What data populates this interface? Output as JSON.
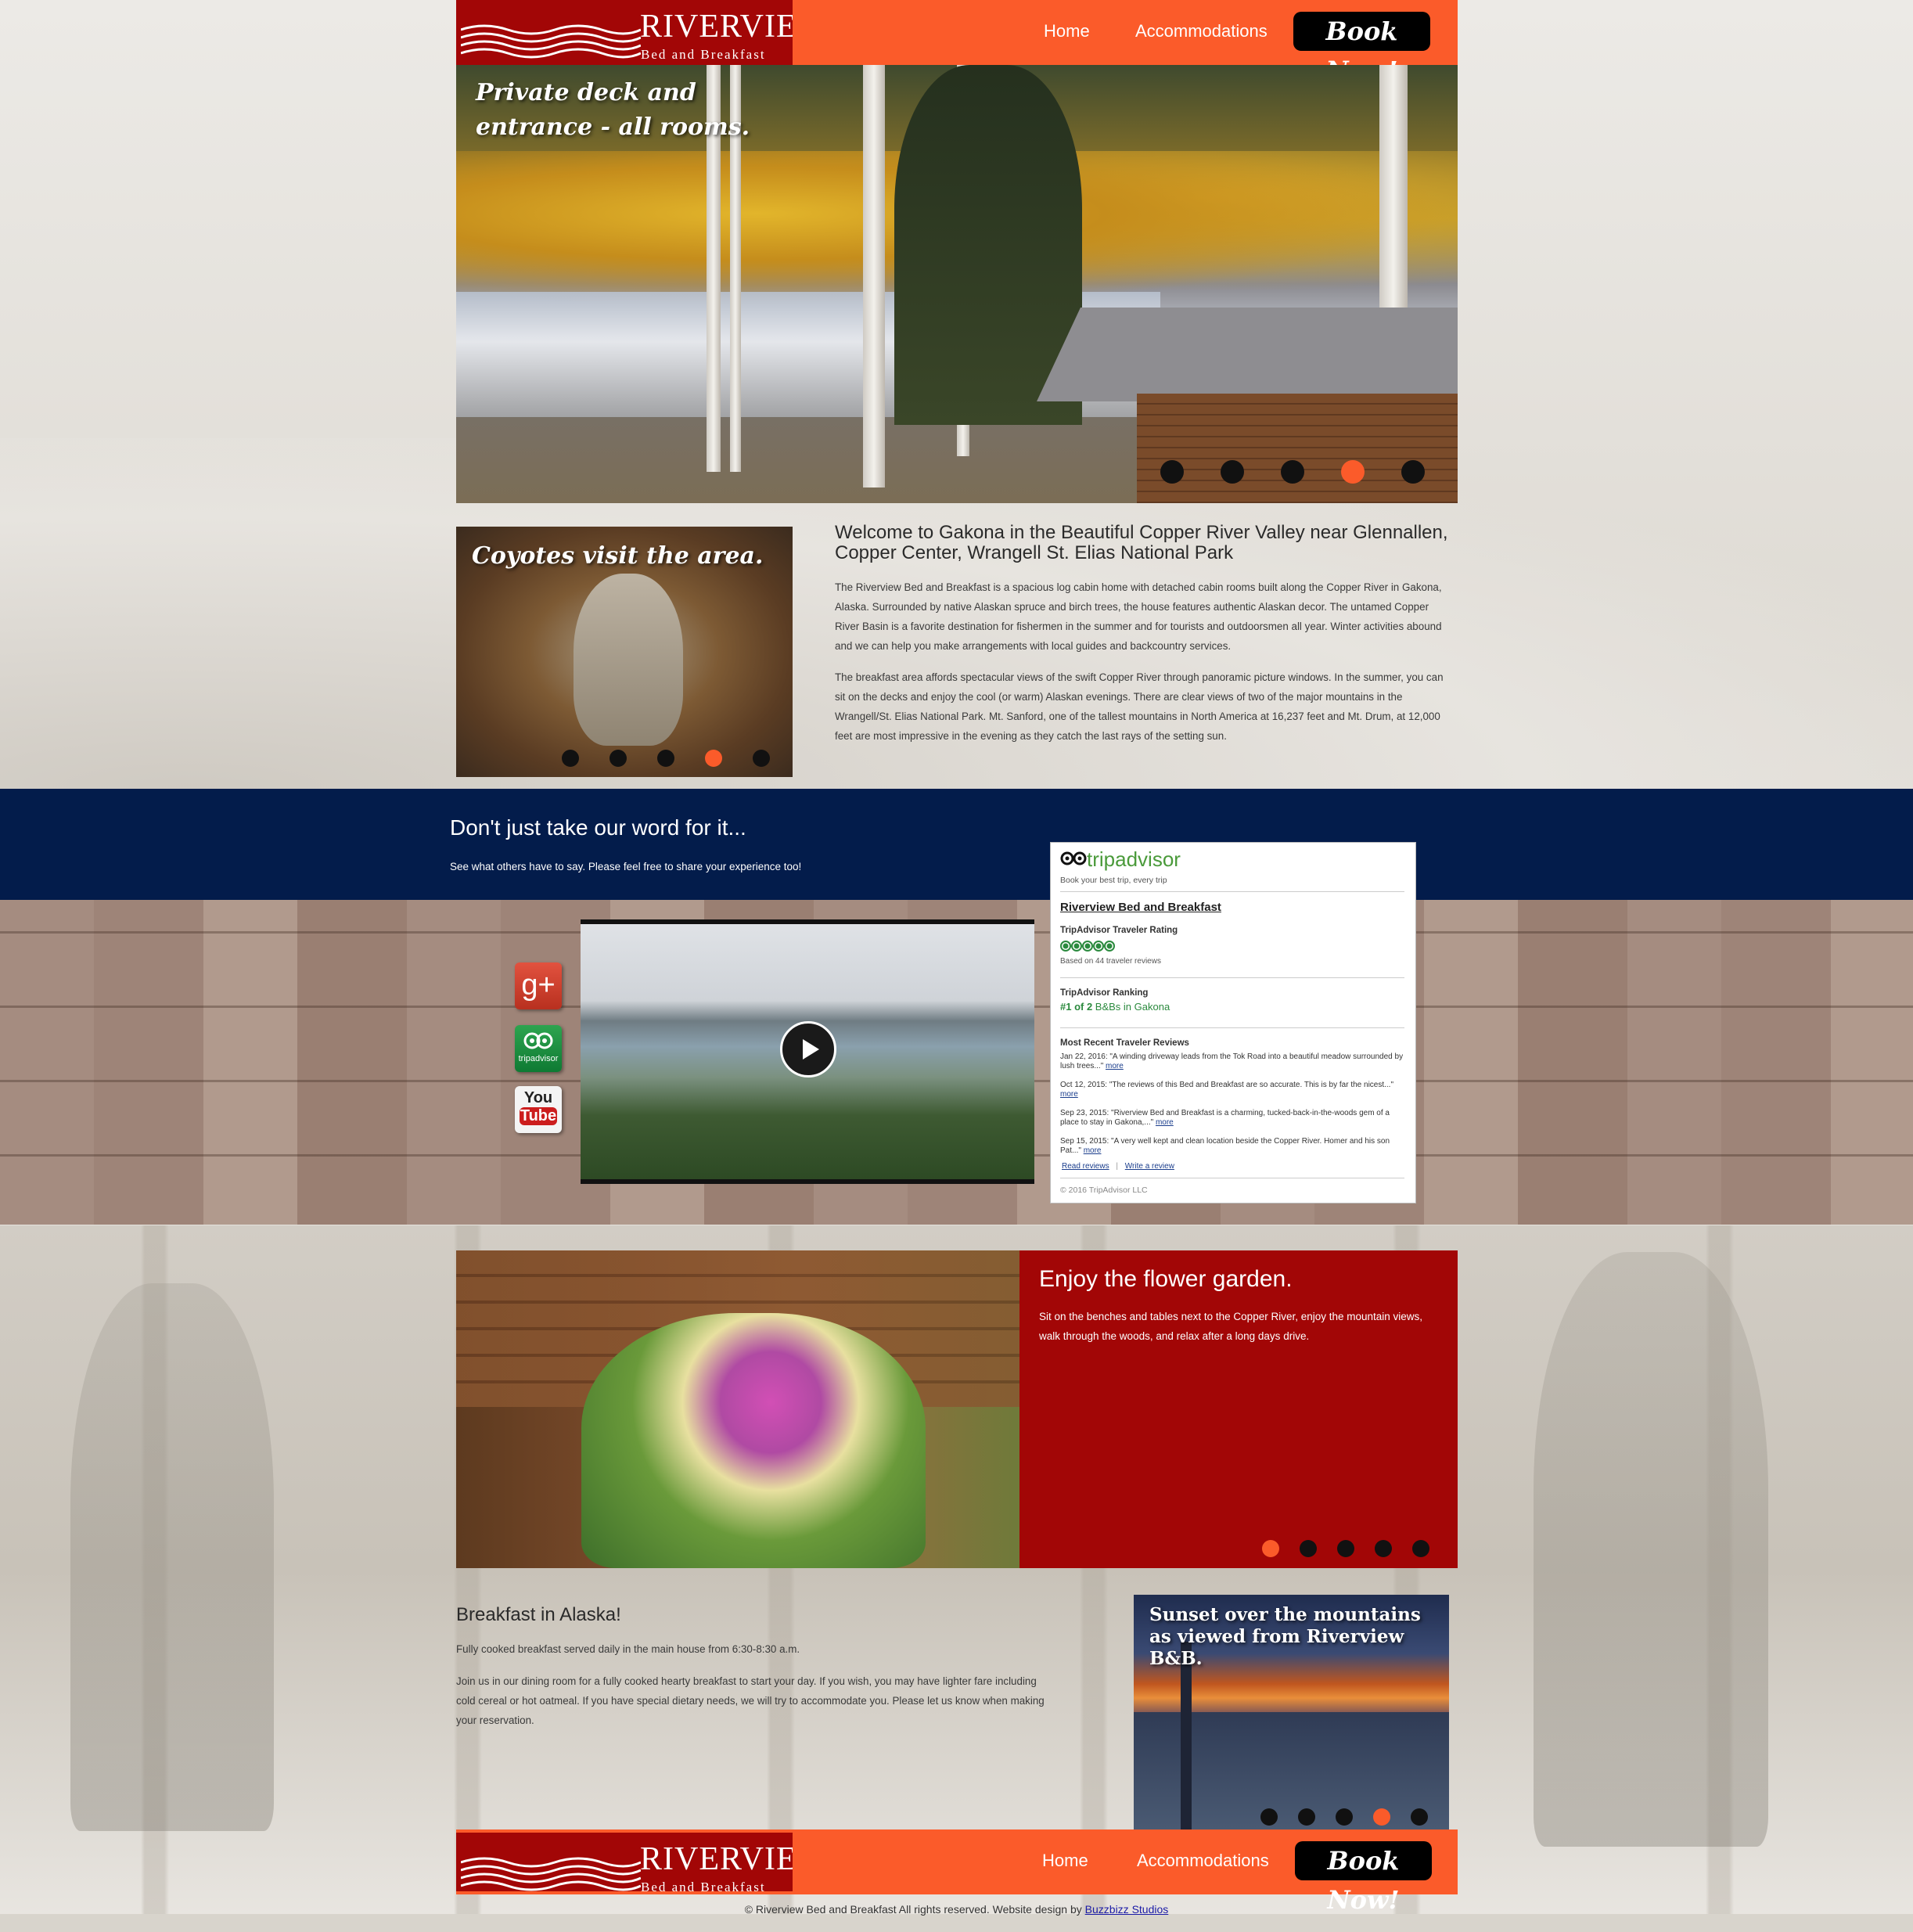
{
  "header": {
    "logo_name": "RIVERVIEW",
    "logo_sub": "Bed and Breakfast",
    "nav": [
      "Home",
      "Accommodations"
    ],
    "book_label": "Book Now!"
  },
  "hero": {
    "caption": "Private deck and entrance - all rooms.",
    "slides": 5,
    "active_slide": 4
  },
  "coyote": {
    "caption": "Coyotes visit the area.",
    "slides": 5,
    "active_slide": 4
  },
  "welcome": {
    "title": "Welcome to Gakona in the Beautiful Copper River Valley near Glennallen, Copper Center, Wrangell St. Elias National Park",
    "p1": "The Riverview Bed and Breakfast is a spacious log cabin home with detached cabin rooms built along the Copper River in Gakona, Alaska. Surrounded by native Alaskan spruce and birch trees, the house features authentic Alaskan decor. The untamed Copper River Basin is a favorite destination for fishermen in the summer and for tourists and outdoorsmen all year. Winter activities abound and we can help you make arrangements with local guides and backcountry services.",
    "p2": "The breakfast area affords spectacular views of the swift Copper River through panoramic picture windows. In the summer, you can sit on the decks and enjoy the cool (or warm) Alaskan evenings. There are clear views of two of the major mountains in the Wrangell/St. Elias National Park. Mt. Sanford, one of the tallest mountains in North America at 16,237 feet and Mt. Drum, at 12,000 feet are most impressive in the evening as they catch the last rays of the setting sun."
  },
  "reviews": {
    "title": "Don't just take our word for it...",
    "subtitle": "See what others have to say. Please feel free to share your experience too!"
  },
  "social": {
    "gplus_label": "g+",
    "tripadvisor_label": "tripadvisor",
    "youtube_top": "You",
    "youtube_bottom": "Tube"
  },
  "tripadvisor": {
    "brand": "tripadvisor",
    "tagline": "Book your best trip, every trip",
    "business": "Riverview Bed and Breakfast",
    "rating_heading": "TripAdvisor Traveler Rating",
    "rating_stars": 5,
    "based_on": "Based on 44 traveler reviews",
    "ranking_heading": "TripAdvisor Ranking",
    "ranking_strong": "#1 of 2",
    "ranking_rest": " B&Bs in Gakona",
    "recent_heading": "Most Recent Traveler Reviews",
    "reviews": [
      {
        "text": "Jan 22, 2016: \"A winding driveway leads from the Tok Road into a beautiful meadow surrounded by lush trees...\"",
        "more": "more"
      },
      {
        "text": "Oct 12, 2015: \"The reviews of this Bed and Breakfast are so accurate. This is by far the nicest...\"",
        "more": "more"
      },
      {
        "text": "Sep 23, 2015: \"Riverview Bed and Breakfast is a charming, tucked-back-in-the-woods gem of a place to stay in Gakona,...\"",
        "more": "more"
      },
      {
        "text": "Sep 15, 2015: \"A very well kept and clean location beside the Copper River. Homer and his son Pat...\"",
        "more": "more"
      }
    ],
    "read_reviews": "Read reviews",
    "write_review": "Write a review",
    "footer": "© 2016 TripAdvisor LLC"
  },
  "garden": {
    "title": "Enjoy the flower garden.",
    "text": "Sit on the benches and tables next to the Copper River, enjoy the mountain views, walk through the woods, and relax after a long days drive.",
    "slides": 5,
    "active_slide": 1
  },
  "breakfast": {
    "title": "Breakfast in Alaska!",
    "p1": "Fully cooked breakfast served daily in the main house from 6:30-8:30 a.m.",
    "p2": "Join us in our dining room for a fully cooked hearty breakfast to start your day. If you wish, you may have lighter fare including cold cereal or hot oatmeal. If you have special dietary needs, we will try to accommodate you. Please let us know when making your reservation."
  },
  "sunset": {
    "caption": "Sunset over the mountains as viewed from Riverview B&B.",
    "slides": 5,
    "active_slide": 4
  },
  "footer": {
    "copyright": "© Riverview Bed and Breakfast All rights reserved. Website design by ",
    "designer": "Buzzbizz Studios"
  }
}
